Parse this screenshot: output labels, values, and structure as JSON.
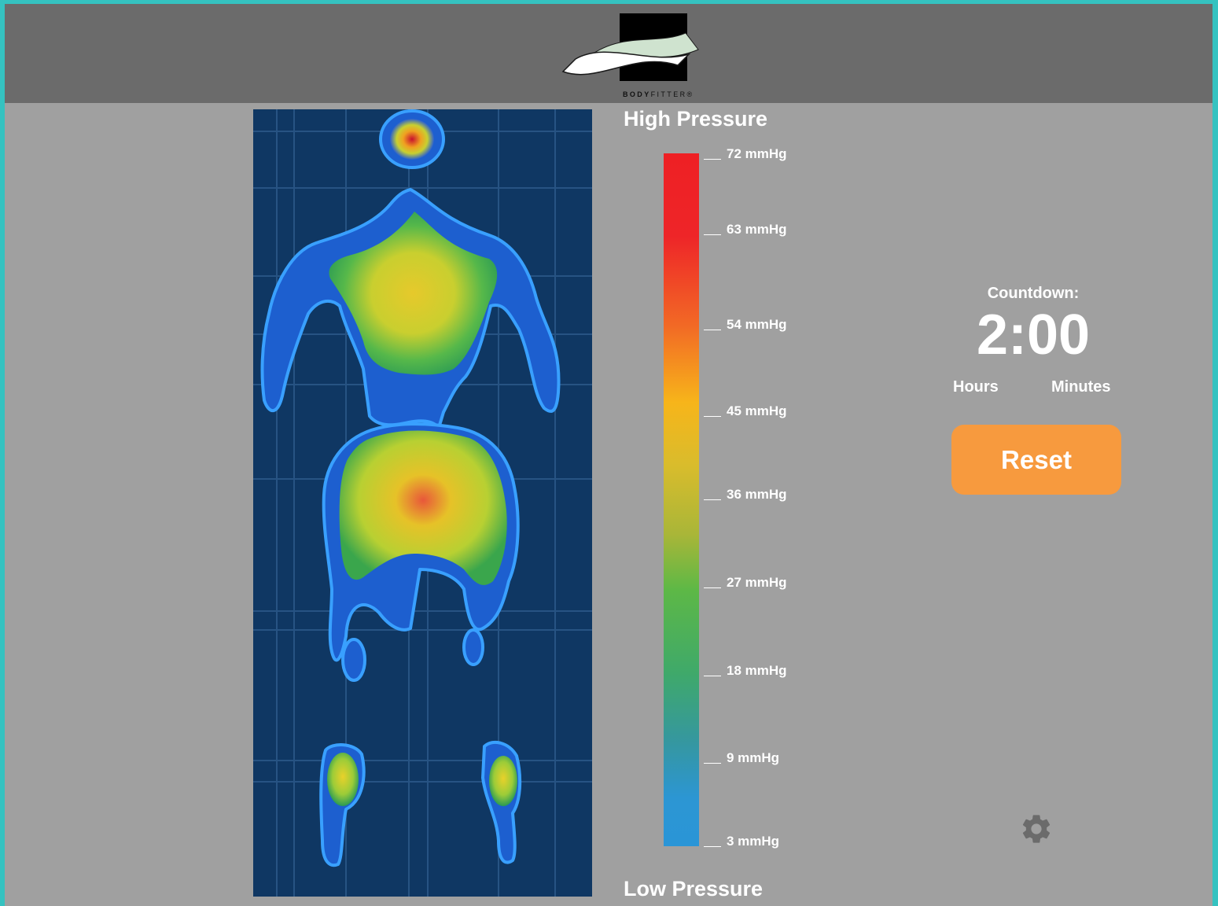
{
  "header": {
    "logo_text_bold": "BODY",
    "logo_text_light": "FITTER",
    "logo_trademark": "®"
  },
  "pressure_scale": {
    "high_label": "High Pressure",
    "low_label": "Low Pressure",
    "ticks": [
      "72 mmHg",
      "63 mmHg",
      "54 mmHg",
      "45 mmHg",
      "36 mmHg",
      "27 mmHg",
      "18 mmHg",
      "9 mmHg",
      "3 mmHg"
    ]
  },
  "countdown": {
    "label": "Countdown:",
    "time": "2:00",
    "hours_label": "Hours",
    "minutes_label": "Minutes"
  },
  "reset_button": {
    "label": "Reset"
  },
  "icons": {
    "settings": "gear-icon"
  },
  "colors": {
    "accent": "#f79a3e",
    "header_bg": "#6b6b6b",
    "panel_bg": "#a0a0a0",
    "heatmap_bg": "#0f3763"
  }
}
